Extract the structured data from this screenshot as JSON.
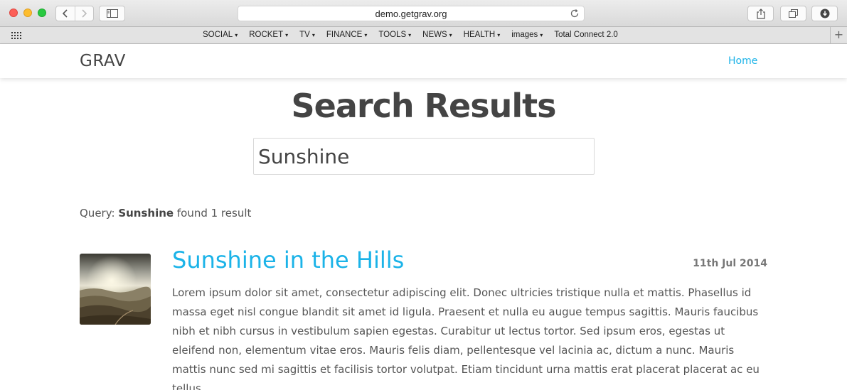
{
  "browser": {
    "url": "demo.getgrav.org",
    "bookmarks": [
      {
        "label": "SOCIAL",
        "dropdown": true
      },
      {
        "label": "ROCKET",
        "dropdown": true
      },
      {
        "label": "TV",
        "dropdown": true
      },
      {
        "label": "FINANCE",
        "dropdown": true
      },
      {
        "label": "TOOLS",
        "dropdown": true
      },
      {
        "label": "NEWS",
        "dropdown": true
      },
      {
        "label": "HEALTH",
        "dropdown": true
      },
      {
        "label": "images",
        "dropdown": true
      },
      {
        "label": "Total Connect 2.0",
        "dropdown": false
      }
    ]
  },
  "site": {
    "logo": "GRAV",
    "nav_home": "Home",
    "accent_color": "#1bb3e8"
  },
  "search": {
    "title": "Search Results",
    "input_value": "Sunshine",
    "query_prefix": "Query: ",
    "query_term": "Sunshine",
    "query_suffix": " found 1 result"
  },
  "results": [
    {
      "title": "Sunshine in the Hills",
      "date": "11th Jul 2014",
      "excerpt": "Lorem ipsum dolor sit amet, consectetur adipiscing elit. Donec ultricies tristique nulla et mattis. Phasellus id massa eget nisl congue blandit sit amet id ligula. Praesent et nulla eu augue tempus sagittis. Mauris faucibus nibh et nibh cursus in vestibulum sapien egestas. Curabitur ut lectus tortor. Sed ipsum eros, egestas ut eleifend non, elementum vitae eros. Mauris felis diam, pellentesque vel lacinia ac, dictum a nunc. Mauris mattis nunc sed mi sagittis et facilisis tortor volutpat. Etiam tincidunt urna mattis erat placerat placerat ac eu tellus."
    }
  ]
}
